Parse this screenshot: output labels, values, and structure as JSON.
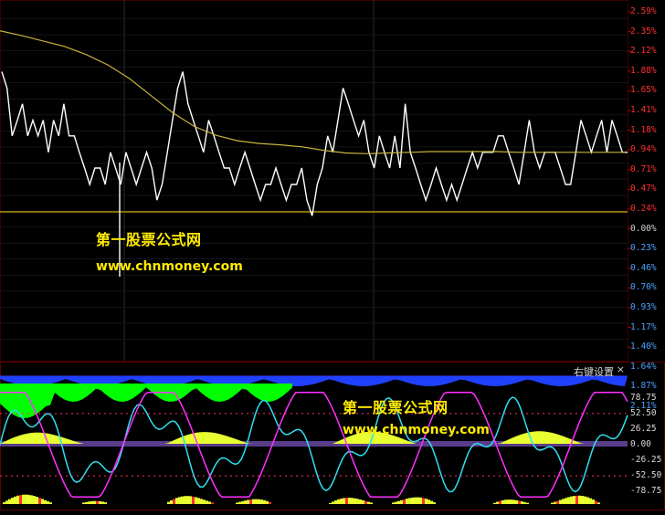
{
  "chart_data": [
    {
      "type": "line",
      "panel": "main",
      "y_ticks": [
        "2.59%",
        "2.35%",
        "2.12%",
        "1.88%",
        "1.65%",
        "1.41%",
        "1.18%",
        "0.94%",
        "0.71%",
        "0.47%",
        "0.24%",
        "0.00%",
        "0.23%",
        "0.46%",
        "0.70%",
        "0.93%",
        "1.17%",
        "1.40%",
        "1.64%",
        "1.87%",
        "2.11%"
      ],
      "ylim": [
        -2.22,
        2.7
      ],
      "series": [
        {
          "kind": "price",
          "color": "#ffffff",
          "values": [
            1.65,
            1.41,
            0.71,
            0.94,
            1.18,
            0.71,
            0.94,
            0.71,
            0.94,
            0.47,
            0.94,
            0.71,
            1.18,
            0.71,
            0.71,
            0.47,
            0.24,
            0.0,
            0.24,
            0.24,
            0.0,
            0.47,
            0.24,
            0.0,
            0.47,
            0.24,
            0.0,
            0.24,
            0.47,
            0.24,
            -0.23,
            0.0,
            0.47,
            0.94,
            1.41,
            1.65,
            1.18,
            0.94,
            0.71,
            0.47,
            0.94,
            0.71,
            0.47,
            0.24,
            0.24,
            0.0,
            0.24,
            0.47,
            0.24,
            0.0,
            -0.23,
            0.0,
            0.0,
            0.24,
            0.0,
            -0.23,
            0.0,
            0.0,
            0.24,
            -0.23,
            -0.46,
            0.0,
            0.24,
            0.71,
            0.47,
            0.94,
            1.41,
            1.18,
            0.94,
            0.71,
            0.94,
            0.47,
            0.24,
            0.71,
            0.47,
            0.24,
            0.71,
            0.24,
            1.18,
            0.47,
            0.24,
            0.0,
            -0.23,
            0.0,
            0.24,
            0.0,
            -0.23,
            0.0,
            -0.23,
            0.0,
            0.24,
            0.47,
            0.24,
            0.47,
            0.47,
            0.47,
            0.71,
            0.71,
            0.47,
            0.24,
            0.0,
            0.47,
            0.94,
            0.47,
            0.24,
            0.47,
            0.47,
            0.47,
            0.24,
            0.0,
            0.0,
            0.47,
            0.94,
            0.71,
            0.47,
            0.71,
            0.94,
            0.47,
            0.94,
            0.71,
            0.47,
            0.47
          ]
        },
        {
          "kind": "average",
          "color": "#c8b43c",
          "values": [
            2.25,
            2.18,
            2.1,
            2.02,
            1.9,
            1.75,
            1.55,
            1.3,
            1.05,
            0.85,
            0.72,
            0.64,
            0.6,
            0.58,
            0.55,
            0.5,
            0.46,
            0.45,
            0.46,
            0.47,
            0.48,
            0.48,
            0.48,
            0.48,
            0.47,
            0.47,
            0.47,
            0.47,
            0.47,
            0.47
          ]
        }
      ]
    },
    {
      "type": "line",
      "panel": "indicator",
      "y_ticks": [
        "78.75",
        "52.50",
        "26.25",
        "0.00",
        "-26.25",
        "-52.50",
        "-78.75"
      ],
      "ylim": [
        -100,
        100
      ]
    }
  ],
  "watermark": {
    "text_cn": "第一股票公式网",
    "url": "www.chnmoney.com"
  },
  "indicator_panel": {
    "menu_label": "右键设置",
    "close_glyph": "×"
  },
  "colors": {
    "price_line": "#ffffff",
    "average_line": "#c8b43c",
    "baseline": "#ffd200",
    "axis_up": "#ff3030",
    "axis_down": "#4aa3ff",
    "cyan_line": "#2ee0f0",
    "magenta_line": "#ff30ff",
    "green_area": "#00ff00",
    "blue_area": "#2040ff",
    "yellow_area": "#e8ff30"
  }
}
